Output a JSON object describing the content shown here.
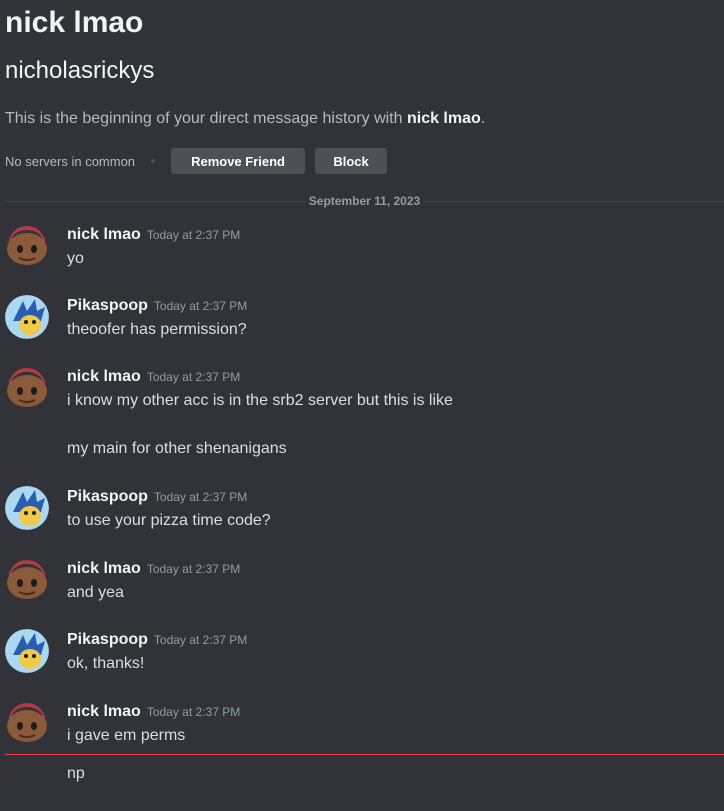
{
  "header": {
    "display_name": "nick lmao",
    "username": "nicholasrickys",
    "intro_prefix": "This is the beginning of your direct message history with ",
    "intro_name": "nick lmao",
    "intro_suffix": ".",
    "mutual_servers": "No servers in common",
    "remove_friend_label": "Remove Friend",
    "block_label": "Block"
  },
  "divider": {
    "date": "September 11, 2023"
  },
  "messages": [
    {
      "author": "nick lmao",
      "timestamp": "Today at 2:37 PM",
      "lines": [
        "yo"
      ]
    },
    {
      "author": "Pikaspoop",
      "timestamp": "Today at 2:37 PM",
      "lines": [
        "theoofer has permission?"
      ]
    },
    {
      "author": "nick lmao",
      "timestamp": "Today at 2:37 PM",
      "lines": [
        "i know my other acc is in the srb2 server but this is like",
        "my main for other shenanigans"
      ]
    },
    {
      "author": "Pikaspoop",
      "timestamp": "Today at 2:37 PM",
      "lines": [
        "to use your pizza time code?"
      ]
    },
    {
      "author": "nick lmao",
      "timestamp": "Today at 2:37 PM",
      "lines": [
        "and yea"
      ]
    },
    {
      "author": "Pikaspoop",
      "timestamp": "Today at 2:37 PM",
      "lines": [
        "ok, thanks!"
      ]
    },
    {
      "author": "nick lmao",
      "timestamp": "Today at 2:37 PM",
      "lines": [
        "i gave em perms"
      ]
    }
  ],
  "followup_message": "np",
  "avatars": {
    "nick": "cartoon-character-avatar",
    "pikaspoop": "blue-hedgehog-avatar"
  },
  "colors": {
    "background": "#313338",
    "button": "#4e5058",
    "new_messages_line": "#f23f43"
  }
}
